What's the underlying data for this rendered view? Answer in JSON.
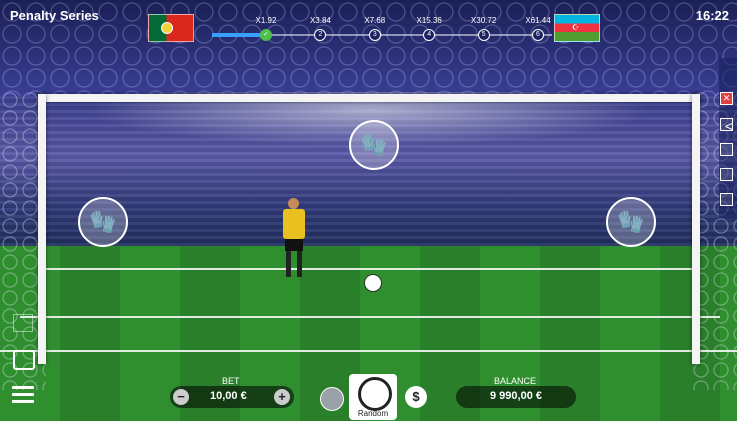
{
  "header": {
    "title": "Penalty Series",
    "clock": "16:22"
  },
  "teams": {
    "left_flag": "Portugal flag",
    "right_flag": "Azerbaijan flag"
  },
  "progress": {
    "filled_fraction": 0.17,
    "multipliers": [
      {
        "label": "X1.92",
        "step": "✓",
        "done": true
      },
      {
        "label": "X3.84",
        "step": "2",
        "done": false
      },
      {
        "label": "X7.68",
        "step": "3",
        "done": false
      },
      {
        "label": "X15.36",
        "step": "4",
        "done": false
      },
      {
        "label": "X30.72",
        "step": "5",
        "done": false
      },
      {
        "label": "X61.44",
        "step": "6",
        "done": false
      }
    ]
  },
  "targets": {
    "left": "glove-icon",
    "center": "glove-icon",
    "right": "glove-icon"
  },
  "side_panel": {
    "toggle": "<"
  },
  "bet": {
    "label": "BET",
    "value": "10,00 €",
    "minus": "−",
    "plus": "+"
  },
  "random": {
    "label": "Random"
  },
  "dollar": {
    "symbol": "$"
  },
  "balance": {
    "label": "BALANCE",
    "value": "9 990,00 €"
  },
  "colors": {
    "accent": "#3aa0ff",
    "done": "#4cc04c",
    "pitch": "#2f8f2f"
  }
}
